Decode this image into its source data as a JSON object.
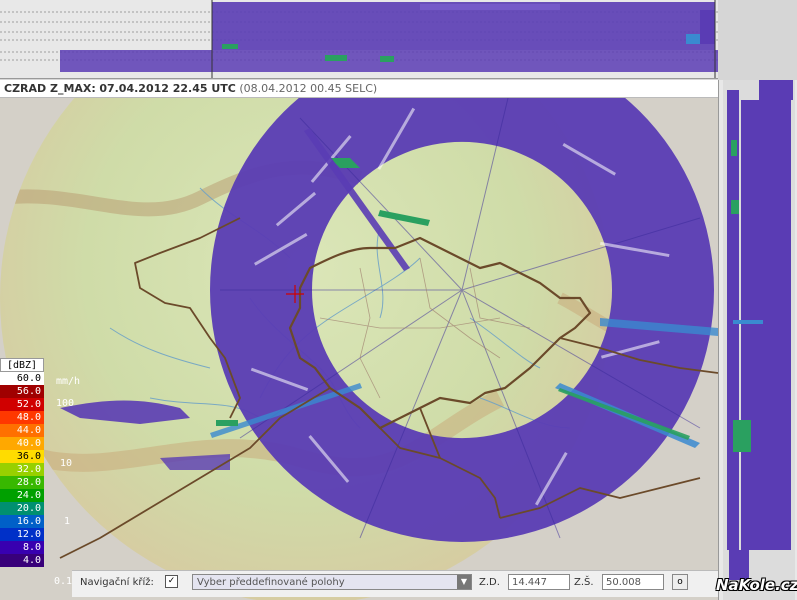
{
  "title": {
    "product": "CZRAD Z_MAX:",
    "utc": "07.04.2012 22.45 UTC",
    "local": "(08.04.2012 00.45 SELC)"
  },
  "legend": {
    "header": "[dBZ]",
    "unit": "mm/h",
    "levels": [
      {
        "value": "60.0",
        "color": "#ffffff",
        "text_color": "#000000"
      },
      {
        "value": "56.0",
        "color": "#a00000",
        "text_color": "#ffffff"
      },
      {
        "value": "52.0",
        "color": "#d00000",
        "text_color": "#ffffff"
      },
      {
        "value": "48.0",
        "color": "#ff3800",
        "text_color": "#ffffff"
      },
      {
        "value": "44.0",
        "color": "#ff7000",
        "text_color": "#ffffff"
      },
      {
        "value": "40.0",
        "color": "#ffa800",
        "text_color": "#ffffff"
      },
      {
        "value": "36.0",
        "color": "#ffdc00",
        "text_color": "#000000"
      },
      {
        "value": "32.0",
        "color": "#98d000",
        "text_color": "#ffffff"
      },
      {
        "value": "28.0",
        "color": "#38b800",
        "text_color": "#ffffff"
      },
      {
        "value": "24.0",
        "color": "#00a000",
        "text_color": "#ffffff"
      },
      {
        "value": "20.0",
        "color": "#009070",
        "text_color": "#ffffff"
      },
      {
        "value": "16.0",
        "color": "#0060c8",
        "text_color": "#ffffff"
      },
      {
        "value": "12.0",
        "color": "#0030c8",
        "text_color": "#ffffff"
      },
      {
        "value": "8.0",
        "color": "#3800b0",
        "text_color": "#ffffff"
      },
      {
        "value": "4.0",
        "color": "#38007a",
        "text_color": "#ffffff"
      }
    ],
    "mm_ticks": [
      "100",
      "10",
      "1",
      "0.1"
    ]
  },
  "nav": {
    "label": "Navigační kříž:",
    "check": "✓",
    "select_placeholder": "Vyber předdefinované polohy",
    "lon_label": "Z.D.",
    "lon_value": "14.447",
    "lat_label": "Z.Š.",
    "lat_value": "50.008",
    "ok_label": "o"
  },
  "watermark": "NaKole.cz",
  "colors": {
    "echo": "#5a3cb4",
    "echo_dark": "#3a2a9a",
    "border": "#6b4a2a",
    "river": "#6aa0c8",
    "terrain_low": "#c8d8a0",
    "terrain_high": "#d8c8a0"
  }
}
